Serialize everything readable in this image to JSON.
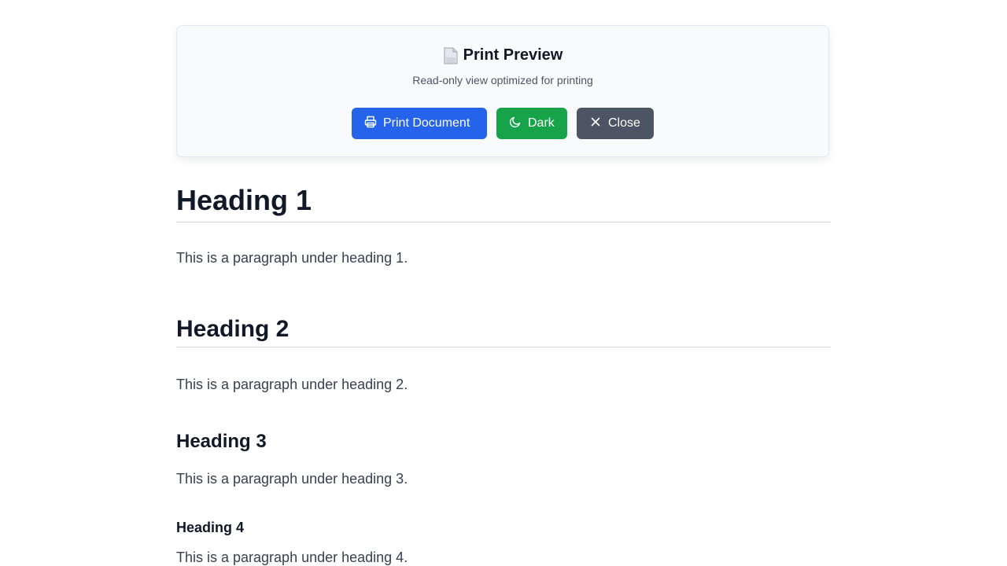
{
  "toolbar": {
    "title": "Print Preview",
    "title_icon": "document-icon",
    "subtitle": "Read-only view optimized for printing",
    "buttons": [
      {
        "label": "Print Document",
        "icon": "printer-icon",
        "color": "#2563eb"
      },
      {
        "label": "Dark",
        "icon": "moon-icon",
        "color": "#16a34a"
      },
      {
        "label": "Close",
        "icon": "close-icon",
        "color": "#4b5563"
      }
    ]
  },
  "document": {
    "sections": [
      {
        "heading": "Heading 1",
        "paragraph": "This is a paragraph under heading 1."
      },
      {
        "heading": "Heading 2",
        "paragraph": "This is a paragraph under heading 2."
      },
      {
        "heading": "Heading 3",
        "paragraph": "This is a paragraph under heading 3."
      },
      {
        "heading": "Heading 4",
        "paragraph": "This is a paragraph under heading 4."
      }
    ]
  }
}
